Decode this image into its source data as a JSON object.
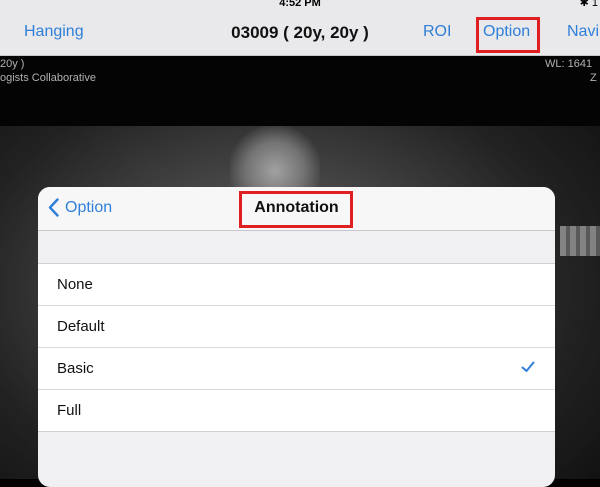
{
  "status": {
    "time": "4:52 PM",
    "right": "✱ 1"
  },
  "nav": {
    "hanging": "Hanging",
    "title": "03009 ( 20y, 20y )",
    "roi": "ROI",
    "option": "Option",
    "navi": "Navi"
  },
  "overlay": {
    "top_left_1": "20y )",
    "top_left_2": "ogists Collaborative",
    "top_right_1": "WL: 1641",
    "top_right_2": "Z"
  },
  "popover": {
    "back_label": "Option",
    "title": "Annotation",
    "items": [
      {
        "label": "None",
        "selected": false
      },
      {
        "label": "Default",
        "selected": false
      },
      {
        "label": "Basic",
        "selected": true
      },
      {
        "label": "Full",
        "selected": false
      }
    ]
  },
  "colors": {
    "accent": "#2f7fd8",
    "highlight": "#e02020"
  },
  "icons": {
    "back": "chevron-left-icon",
    "check": "checkmark-icon"
  }
}
